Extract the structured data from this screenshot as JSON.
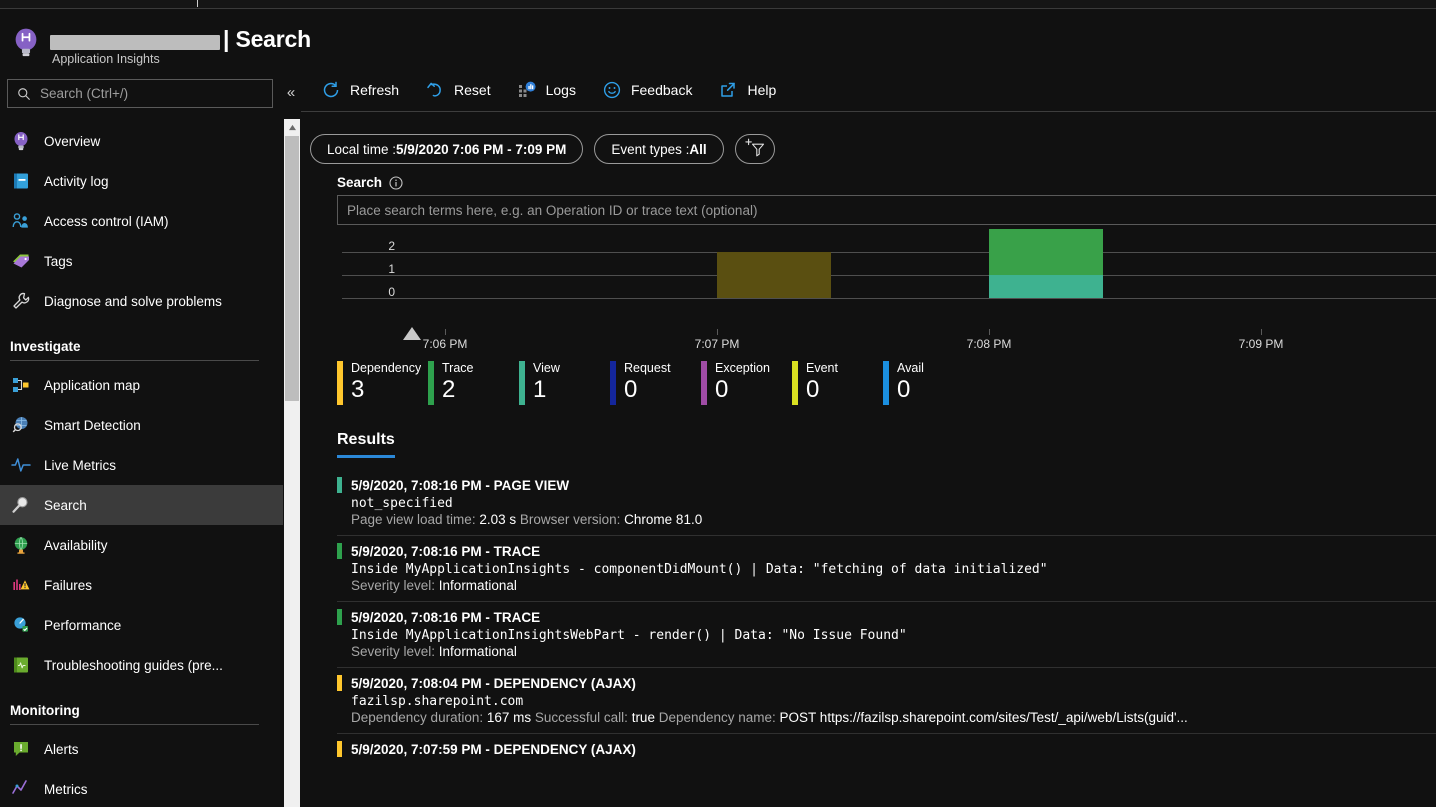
{
  "header": {
    "resource_name_redacted": true,
    "separator": "|",
    "title": "Search",
    "subtitle": "Application Insights",
    "icon": "lightbulb-icon"
  },
  "sidebar": {
    "search": {
      "placeholder": "Search (Ctrl+/)",
      "icon": "search-icon"
    },
    "collapse_label": "«",
    "items": [
      {
        "label": "Overview",
        "icon": "lightbulb-icon",
        "selected": false
      },
      {
        "label": "Activity log",
        "icon": "activity-log-icon",
        "selected": false
      },
      {
        "label": "Access control (IAM)",
        "icon": "people-icon",
        "selected": false
      },
      {
        "label": "Tags",
        "icon": "tags-icon",
        "selected": false
      },
      {
        "label": "Diagnose and solve problems",
        "icon": "wrench-icon",
        "selected": false
      }
    ],
    "groups": [
      {
        "title": "Investigate",
        "items": [
          {
            "label": "Application map",
            "icon": "application-map-icon",
            "selected": false
          },
          {
            "label": "Smart Detection",
            "icon": "smart-detection-icon",
            "selected": false
          },
          {
            "label": "Live Metrics",
            "icon": "live-metrics-icon",
            "selected": false
          },
          {
            "label": "Search",
            "icon": "search-icon",
            "selected": true
          },
          {
            "label": "Availability",
            "icon": "globe-icon",
            "selected": false
          },
          {
            "label": "Failures",
            "icon": "failures-icon",
            "selected": false
          },
          {
            "label": "Performance",
            "icon": "performance-icon",
            "selected": false
          },
          {
            "label": "Troubleshooting guides (pre...",
            "icon": "troubleshooting-icon",
            "selected": false
          }
        ]
      },
      {
        "title": "Monitoring",
        "items": [
          {
            "label": "Alerts",
            "icon": "alerts-icon",
            "selected": false
          },
          {
            "label": "Metrics",
            "icon": "metrics-icon",
            "selected": false
          }
        ]
      }
    ]
  },
  "toolbar": {
    "refresh": "Refresh",
    "reset": "Reset",
    "logs": "Logs",
    "feedback": "Feedback",
    "help": "Help"
  },
  "filters": {
    "time_label": "Local time : ",
    "time_value": "5/9/2020 7:06 PM - 7:09 PM",
    "event_label": "Event types : ",
    "event_value": "All",
    "add_filter_icon": "add-filter-icon"
  },
  "search": {
    "label": "Search",
    "info_icon": "info-icon",
    "placeholder": "Place search terms here, e.g. an Operation ID or trace text (optional)",
    "value": ""
  },
  "chart_data": {
    "type": "bar",
    "title": "",
    "xlabel": "",
    "ylabel": "",
    "stacked": true,
    "grid": true,
    "legend_position": "below",
    "ylim": [
      0,
      2.4
    ],
    "yticks": [
      "0",
      "1",
      "2"
    ],
    "xticks": [
      "7:06 PM",
      "7:07 PM",
      "7:08 PM",
      "7:09 PM"
    ],
    "x": [
      "7:06 PM",
      "7:07 PM",
      "7:08 PM",
      "7:09 PM"
    ],
    "bars": [
      {
        "time": "7:06:40 PM",
        "series": "Dependency",
        "value": 2,
        "color": "#5a4f11",
        "dimmed": true
      },
      {
        "time": "7:08:00 PM",
        "series": "View",
        "value": 1,
        "color": "#3eb290",
        "dimmed": false
      },
      {
        "time": "7:08:00 PM",
        "series": "Trace",
        "value": 2,
        "color": "#39a149",
        "dimmed": false
      }
    ],
    "series": [
      {
        "name": "Dependency",
        "color": "#ffc72d",
        "total": 3,
        "values": [
          0,
          2,
          0,
          0
        ]
      },
      {
        "name": "Trace",
        "color": "#2ea14d",
        "total": 2,
        "values": [
          0,
          0,
          2,
          0
        ]
      },
      {
        "name": "View",
        "color": "#3eb290",
        "total": 1,
        "values": [
          0,
          0,
          1,
          0
        ]
      },
      {
        "name": "Request",
        "color": "#14269c",
        "total": 0,
        "values": [
          0,
          0,
          0,
          0
        ]
      },
      {
        "name": "Exception",
        "color": "#9f4ca5",
        "total": 0,
        "values": [
          0,
          0,
          0,
          0
        ]
      },
      {
        "name": "Event",
        "color": "#d9e021",
        "total": 0,
        "values": [
          0,
          0,
          0,
          0
        ]
      },
      {
        "name": "Avail",
        "color": "#1b8fe0",
        "total": 0,
        "values": [
          0,
          0,
          0,
          0
        ]
      }
    ]
  },
  "legend": [
    {
      "name": "Dependency",
      "value": "3",
      "color": "#ffc72d"
    },
    {
      "name": "Trace",
      "value": "2",
      "color": "#2ea14d"
    },
    {
      "name": "View",
      "value": "1",
      "color": "#3eb290"
    },
    {
      "name": "Request",
      "value": "0",
      "color": "#14269c"
    },
    {
      "name": "Exception",
      "value": "0",
      "color": "#9f4ca5"
    },
    {
      "name": "Event",
      "value": "0",
      "color": "#d9e021"
    },
    {
      "name": "Avail",
      "value": "0",
      "color": "#1b8fe0"
    }
  ],
  "results": {
    "title": "Results",
    "items": [
      {
        "title": "5/9/2020, 7:08:16 PM - PAGE VIEW",
        "bar_color": "#3eb290",
        "mono": "not_specified",
        "meta": [
          {
            "key": "Page view load time: ",
            "val": "2.03 s"
          },
          {
            "key": "Browser version: ",
            "val": "Chrome 81.0"
          }
        ]
      },
      {
        "title": "5/9/2020, 7:08:16 PM - TRACE",
        "bar_color": "#2ea14d",
        "mono": "Inside MyApplicationInsights - componentDidMount() | Data: \"fetching of data initialized\"",
        "meta": [
          {
            "key": "Severity level: ",
            "val": "Informational"
          }
        ]
      },
      {
        "title": "5/9/2020, 7:08:16 PM - TRACE",
        "bar_color": "#2ea14d",
        "mono": "Inside MyApplicationInsightsWebPart - render() | Data: \"No Issue Found\"",
        "meta": [
          {
            "key": "Severity level: ",
            "val": "Informational"
          }
        ]
      },
      {
        "title": "5/9/2020, 7:08:04 PM - DEPENDENCY (AJAX)",
        "bar_color": "#ffc72d",
        "mono": "fazilsp.sharepoint.com",
        "meta": [
          {
            "key": "Dependency duration: ",
            "val": "167 ms"
          },
          {
            "key": "Successful call: ",
            "val": "true"
          },
          {
            "key": "Dependency name: ",
            "val": "POST https://fazilsp.sharepoint.com/sites/Test/_api/web/Lists(guid'..."
          }
        ]
      },
      {
        "title": "5/9/2020, 7:07:59 PM - DEPENDENCY (AJAX)",
        "bar_color": "#ffc72d",
        "mono": "",
        "meta": []
      }
    ]
  }
}
